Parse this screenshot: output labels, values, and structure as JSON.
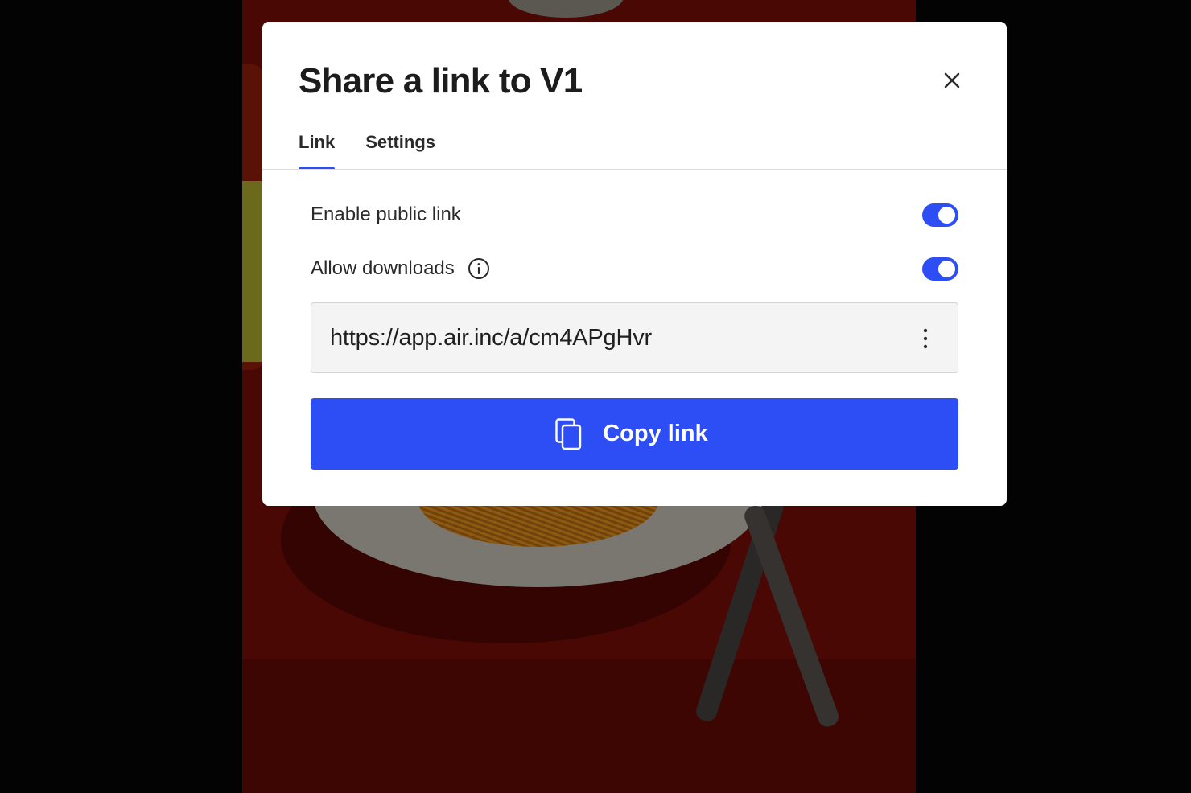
{
  "modal": {
    "title": "Share a link to V1",
    "close_icon": "close-icon"
  },
  "tabs": [
    {
      "label": "Link",
      "active": true
    },
    {
      "label": "Settings",
      "active": false
    }
  ],
  "options": {
    "public_link": {
      "label": "Enable public link",
      "enabled": true
    },
    "downloads": {
      "label": "Allow downloads",
      "enabled": true,
      "info_icon": "info-icon"
    }
  },
  "link_field": {
    "value": "https://app.air.inc/a/cm4APgHvr",
    "menu_icon": "more-vertical-icon"
  },
  "copy_button": {
    "label": "Copy link",
    "icon": "copy-icon"
  },
  "colors": {
    "accent": "#2d4ef5",
    "text": "#1c1c1c",
    "overlay": "#000000"
  }
}
